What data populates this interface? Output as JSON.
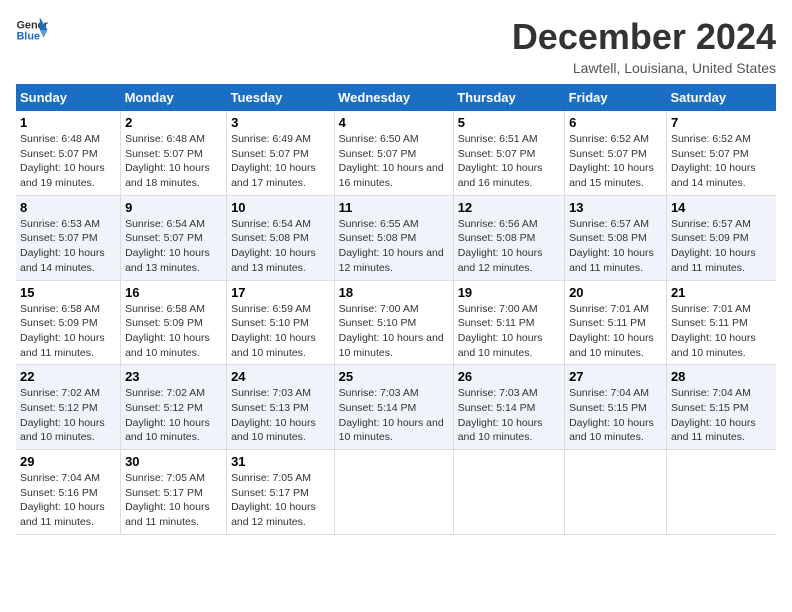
{
  "header": {
    "logo_line1": "General",
    "logo_line2": "Blue",
    "month_title": "December 2024",
    "location": "Lawtell, Louisiana, United States"
  },
  "columns": [
    "Sunday",
    "Monday",
    "Tuesday",
    "Wednesday",
    "Thursday",
    "Friday",
    "Saturday"
  ],
  "weeks": [
    [
      {
        "day": "1",
        "sunrise": "Sunrise: 6:48 AM",
        "sunset": "Sunset: 5:07 PM",
        "daylight": "Daylight: 10 hours and 19 minutes."
      },
      {
        "day": "2",
        "sunrise": "Sunrise: 6:48 AM",
        "sunset": "Sunset: 5:07 PM",
        "daylight": "Daylight: 10 hours and 18 minutes."
      },
      {
        "day": "3",
        "sunrise": "Sunrise: 6:49 AM",
        "sunset": "Sunset: 5:07 PM",
        "daylight": "Daylight: 10 hours and 17 minutes."
      },
      {
        "day": "4",
        "sunrise": "Sunrise: 6:50 AM",
        "sunset": "Sunset: 5:07 PM",
        "daylight": "Daylight: 10 hours and 16 minutes."
      },
      {
        "day": "5",
        "sunrise": "Sunrise: 6:51 AM",
        "sunset": "Sunset: 5:07 PM",
        "daylight": "Daylight: 10 hours and 16 minutes."
      },
      {
        "day": "6",
        "sunrise": "Sunrise: 6:52 AM",
        "sunset": "Sunset: 5:07 PM",
        "daylight": "Daylight: 10 hours and 15 minutes."
      },
      {
        "day": "7",
        "sunrise": "Sunrise: 6:52 AM",
        "sunset": "Sunset: 5:07 PM",
        "daylight": "Daylight: 10 hours and 14 minutes."
      }
    ],
    [
      {
        "day": "8",
        "sunrise": "Sunrise: 6:53 AM",
        "sunset": "Sunset: 5:07 PM",
        "daylight": "Daylight: 10 hours and 14 minutes."
      },
      {
        "day": "9",
        "sunrise": "Sunrise: 6:54 AM",
        "sunset": "Sunset: 5:07 PM",
        "daylight": "Daylight: 10 hours and 13 minutes."
      },
      {
        "day": "10",
        "sunrise": "Sunrise: 6:54 AM",
        "sunset": "Sunset: 5:08 PM",
        "daylight": "Daylight: 10 hours and 13 minutes."
      },
      {
        "day": "11",
        "sunrise": "Sunrise: 6:55 AM",
        "sunset": "Sunset: 5:08 PM",
        "daylight": "Daylight: 10 hours and 12 minutes."
      },
      {
        "day": "12",
        "sunrise": "Sunrise: 6:56 AM",
        "sunset": "Sunset: 5:08 PM",
        "daylight": "Daylight: 10 hours and 12 minutes."
      },
      {
        "day": "13",
        "sunrise": "Sunrise: 6:57 AM",
        "sunset": "Sunset: 5:08 PM",
        "daylight": "Daylight: 10 hours and 11 minutes."
      },
      {
        "day": "14",
        "sunrise": "Sunrise: 6:57 AM",
        "sunset": "Sunset: 5:09 PM",
        "daylight": "Daylight: 10 hours and 11 minutes."
      }
    ],
    [
      {
        "day": "15",
        "sunrise": "Sunrise: 6:58 AM",
        "sunset": "Sunset: 5:09 PM",
        "daylight": "Daylight: 10 hours and 11 minutes."
      },
      {
        "day": "16",
        "sunrise": "Sunrise: 6:58 AM",
        "sunset": "Sunset: 5:09 PM",
        "daylight": "Daylight: 10 hours and 10 minutes."
      },
      {
        "day": "17",
        "sunrise": "Sunrise: 6:59 AM",
        "sunset": "Sunset: 5:10 PM",
        "daylight": "Daylight: 10 hours and 10 minutes."
      },
      {
        "day": "18",
        "sunrise": "Sunrise: 7:00 AM",
        "sunset": "Sunset: 5:10 PM",
        "daylight": "Daylight: 10 hours and 10 minutes."
      },
      {
        "day": "19",
        "sunrise": "Sunrise: 7:00 AM",
        "sunset": "Sunset: 5:11 PM",
        "daylight": "Daylight: 10 hours and 10 minutes."
      },
      {
        "day": "20",
        "sunrise": "Sunrise: 7:01 AM",
        "sunset": "Sunset: 5:11 PM",
        "daylight": "Daylight: 10 hours and 10 minutes."
      },
      {
        "day": "21",
        "sunrise": "Sunrise: 7:01 AM",
        "sunset": "Sunset: 5:11 PM",
        "daylight": "Daylight: 10 hours and 10 minutes."
      }
    ],
    [
      {
        "day": "22",
        "sunrise": "Sunrise: 7:02 AM",
        "sunset": "Sunset: 5:12 PM",
        "daylight": "Daylight: 10 hours and 10 minutes."
      },
      {
        "day": "23",
        "sunrise": "Sunrise: 7:02 AM",
        "sunset": "Sunset: 5:12 PM",
        "daylight": "Daylight: 10 hours and 10 minutes."
      },
      {
        "day": "24",
        "sunrise": "Sunrise: 7:03 AM",
        "sunset": "Sunset: 5:13 PM",
        "daylight": "Daylight: 10 hours and 10 minutes."
      },
      {
        "day": "25",
        "sunrise": "Sunrise: 7:03 AM",
        "sunset": "Sunset: 5:14 PM",
        "daylight": "Daylight: 10 hours and 10 minutes."
      },
      {
        "day": "26",
        "sunrise": "Sunrise: 7:03 AM",
        "sunset": "Sunset: 5:14 PM",
        "daylight": "Daylight: 10 hours and 10 minutes."
      },
      {
        "day": "27",
        "sunrise": "Sunrise: 7:04 AM",
        "sunset": "Sunset: 5:15 PM",
        "daylight": "Daylight: 10 hours and 10 minutes."
      },
      {
        "day": "28",
        "sunrise": "Sunrise: 7:04 AM",
        "sunset": "Sunset: 5:15 PM",
        "daylight": "Daylight: 10 hours and 11 minutes."
      }
    ],
    [
      {
        "day": "29",
        "sunrise": "Sunrise: 7:04 AM",
        "sunset": "Sunset: 5:16 PM",
        "daylight": "Daylight: 10 hours and 11 minutes."
      },
      {
        "day": "30",
        "sunrise": "Sunrise: 7:05 AM",
        "sunset": "Sunset: 5:17 PM",
        "daylight": "Daylight: 10 hours and 11 minutes."
      },
      {
        "day": "31",
        "sunrise": "Sunrise: 7:05 AM",
        "sunset": "Sunset: 5:17 PM",
        "daylight": "Daylight: 10 hours and 12 minutes."
      },
      null,
      null,
      null,
      null
    ]
  ]
}
